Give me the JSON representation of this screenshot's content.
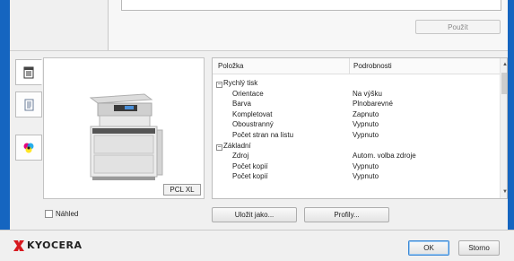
{
  "top_panel": {
    "apply_button": "Použít"
  },
  "sidebar_tools": [
    {
      "icon": "printer-settings-icon",
      "active": true
    },
    {
      "icon": "document-list-icon",
      "active": false
    },
    {
      "icon": "color-icon",
      "active": false
    }
  ],
  "preview": {
    "pdl_badge": "PCL XL",
    "preview_checkbox_label": "Náhled",
    "preview_checked": false
  },
  "table": {
    "columns": [
      "Položka",
      "Podrobnosti"
    ],
    "rows": [
      {
        "group": true,
        "label": "Rychlý tisk",
        "value": ""
      },
      {
        "group": false,
        "label": "Orientace",
        "value": "Na výšku"
      },
      {
        "group": false,
        "label": "Barva",
        "value": "Plnobarevné"
      },
      {
        "group": false,
        "label": "Kompletovat",
        "value": "Zapnuto"
      },
      {
        "group": false,
        "label": "Oboustranný",
        "value": "Vypnuto"
      },
      {
        "group": false,
        "label": "Počet stran na listu",
        "value": "Vypnuto"
      },
      {
        "group": true,
        "label": "Základní",
        "value": ""
      },
      {
        "group": false,
        "label": "Zdroj",
        "value": "Autom. volba zdroje"
      },
      {
        "group": false,
        "label": "Počet kopií",
        "value": "Vypnuto"
      },
      {
        "group": false,
        "label": "Počet kopií",
        "value": "Vypnuto"
      }
    ]
  },
  "actions": {
    "save_as": "Uložit jako...",
    "profiles": "Profily..."
  },
  "footer": {
    "brand": "KYOCERA",
    "ok": "OK",
    "cancel": "Storno"
  },
  "colors": {
    "window_edge": "#1565c0",
    "brand_red": "#d71920"
  }
}
